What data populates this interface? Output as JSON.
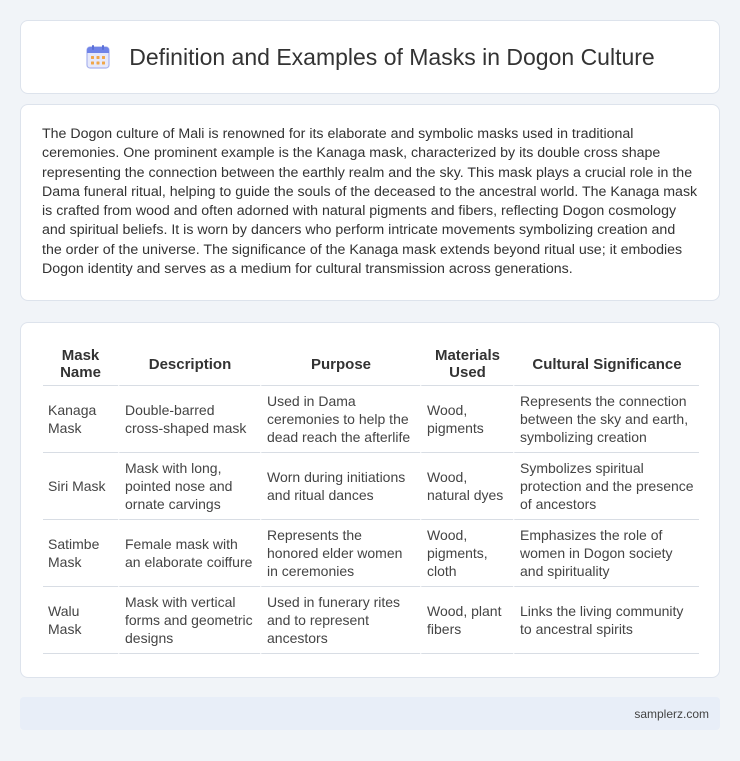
{
  "header": {
    "title": "Definition and Examples of Masks in Dogon Culture",
    "icon": "calendar-icon"
  },
  "intro": {
    "text": "The Dogon culture of Mali is renowned for its elaborate and symbolic masks used in traditional ceremonies. One prominent example is the Kanaga mask, characterized by its double cross shape representing the connection between the earthly realm and the sky. This mask plays a crucial role in the Dama funeral ritual, helping to guide the souls of the deceased to the ancestral world. The Kanaga mask is crafted from wood and often adorned with natural pigments and fibers, reflecting Dogon cosmology and spiritual beliefs. It is worn by dancers who perform intricate movements symbolizing creation and the order of the universe. The significance of the Kanaga mask extends beyond ritual use; it embodies Dogon identity and serves as a medium for cultural transmission across generations."
  },
  "table": {
    "headers": [
      "Mask Name",
      "Description",
      "Purpose",
      "Materials Used",
      "Cultural Significance"
    ],
    "rows": [
      [
        "Kanaga Mask",
        "Double-barred cross-shaped mask",
        "Used in Dama ceremonies to help the dead reach the afterlife",
        "Wood, pigments",
        "Represents the connection between the sky and earth, symbolizing creation"
      ],
      [
        "Siri Mask",
        "Mask with long, pointed nose and ornate carvings",
        "Worn during initiations and ritual dances",
        "Wood, natural dyes",
        "Symbolizes spiritual protection and the presence of ancestors"
      ],
      [
        "Satimbe Mask",
        "Female mask with an elaborate coiffure",
        "Represents the honored elder women in ceremonies",
        "Wood, pigments, cloth",
        "Emphasizes the role of women in Dogon society and spirituality"
      ],
      [
        "Walu Mask",
        "Mask with vertical forms and geometric designs",
        "Used in funerary rites and to represent ancestors",
        "Wood, plant fibers",
        "Links the living community to ancestral spirits"
      ]
    ]
  },
  "footer": {
    "site": "samplerz.com"
  }
}
